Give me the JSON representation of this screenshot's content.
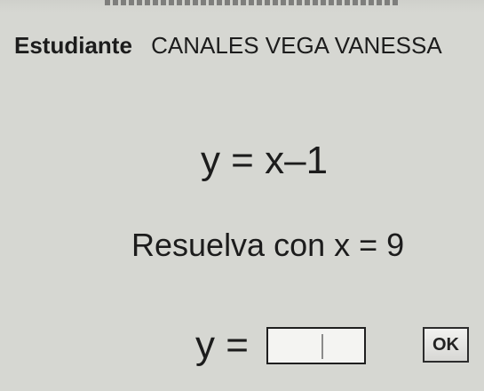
{
  "student": {
    "label": "Estudiante",
    "name": "CANALES VEGA VANESSA"
  },
  "problem": {
    "equation": "y = x–1",
    "instruction": "Resuelva con x = 9"
  },
  "answer": {
    "prefix": "y =",
    "value": ""
  },
  "ok_button": {
    "label": "OK"
  }
}
